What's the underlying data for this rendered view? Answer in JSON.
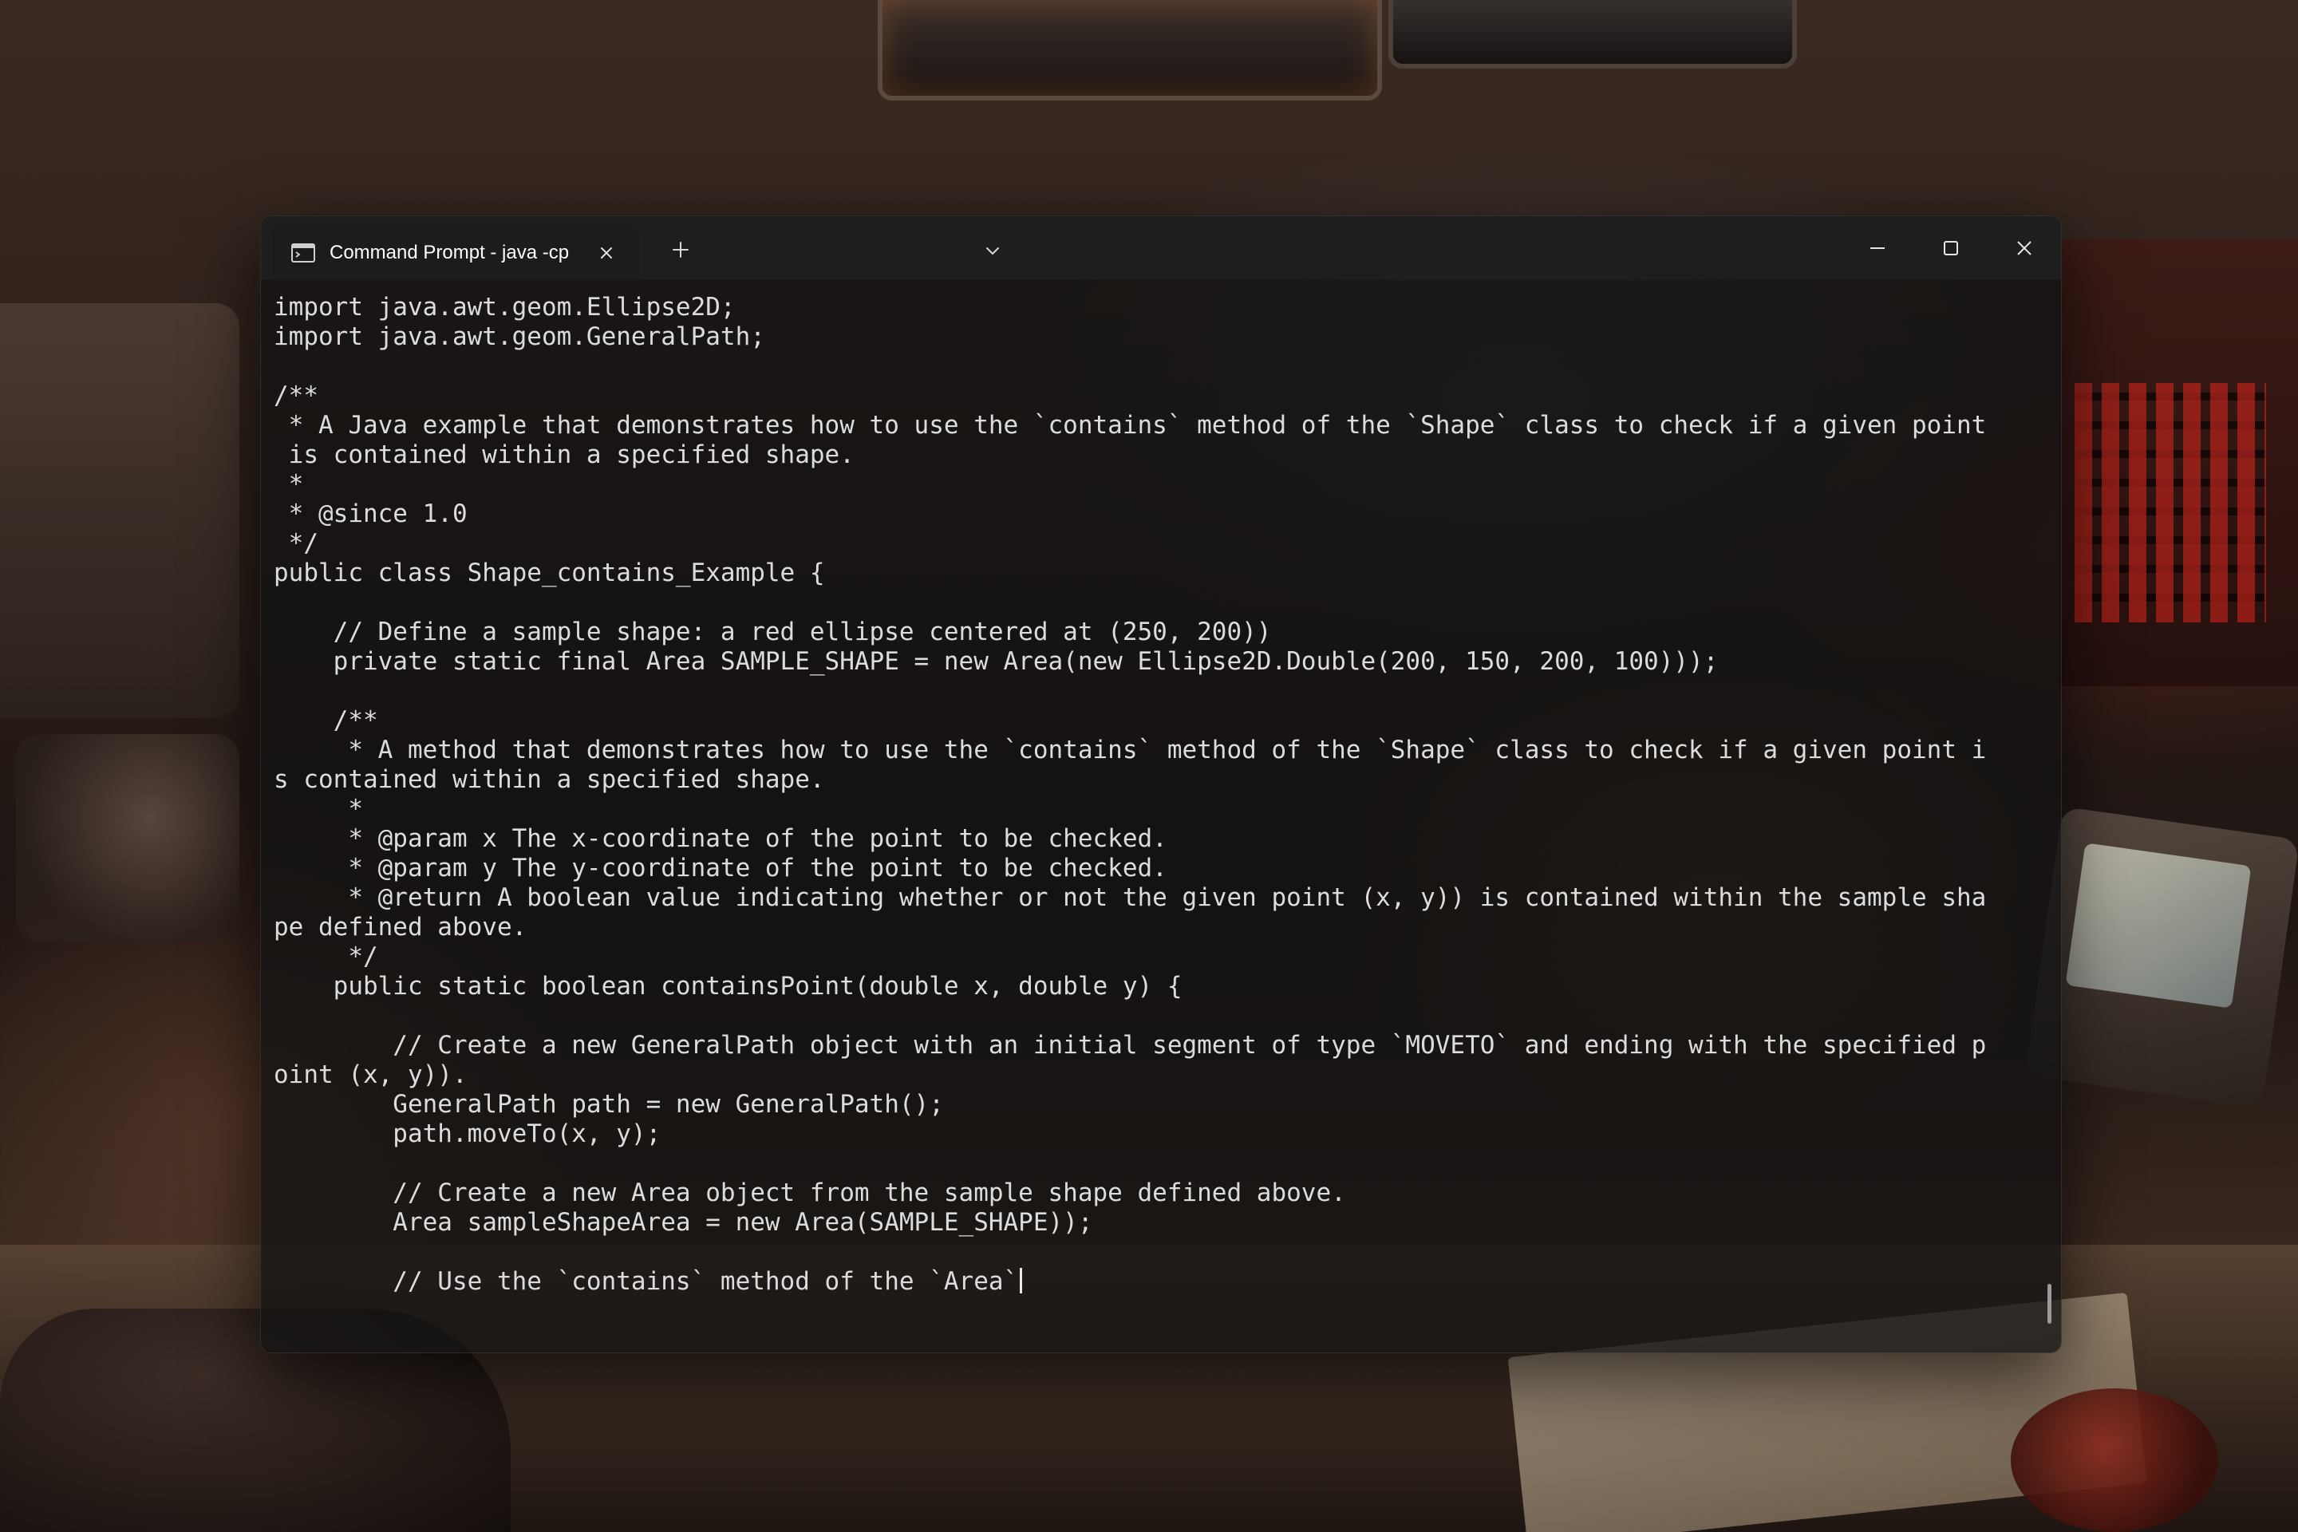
{
  "window": {
    "tab_title": "Command Prompt - java  -cp",
    "icons": {
      "tab": "terminal-icon",
      "close_tab": "close-icon",
      "new_tab": "plus-icon",
      "dropdown": "chevron-down-icon",
      "minimize": "minimize-icon",
      "maximize": "maximize-icon",
      "close_window": "close-icon"
    }
  },
  "terminal": {
    "lines": [
      "import java.awt.geom.Ellipse2D;",
      "import java.awt.geom.GeneralPath;",
      "",
      "/**",
      " * A Java example that demonstrates how to use the `contains` method of the `Shape` class to check if a given point",
      " is contained within a specified shape.",
      " *",
      " * @since 1.0",
      " */",
      "public class Shape_contains_Example {",
      "",
      "    // Define a sample shape: a red ellipse centered at (250, 200))",
      "    private static final Area SAMPLE_SHAPE = new Area(new Ellipse2D.Double(200, 150, 200, 100)));",
      "",
      "    /**",
      "     * A method that demonstrates how to use the `contains` method of the `Shape` class to check if a given point i",
      "s contained within a specified shape.",
      "     *",
      "     * @param x The x-coordinate of the point to be checked.",
      "     * @param y The y-coordinate of the point to be checked.",
      "     * @return A boolean value indicating whether or not the given point (x, y)) is contained within the sample sha",
      "pe defined above.",
      "     */",
      "    public static boolean containsPoint(double x, double y) {",
      "",
      "        // Create a new GeneralPath object with an initial segment of type `MOVETO` and ending with the specified p",
      "oint (x, y)).",
      "        GeneralPath path = new GeneralPath();",
      "        path.moveTo(x, y);",
      "",
      "        // Create a new Area object from the sample shape defined above.",
      "        Area sampleShapeArea = new Area(SAMPLE_SHAPE));",
      "",
      "        // Use the `contains` method of the `Area`"
    ]
  },
  "colors": {
    "terminal_text": "#dcdcdc",
    "window_bg": "#121212",
    "titlebar_bg": "#202020"
  }
}
